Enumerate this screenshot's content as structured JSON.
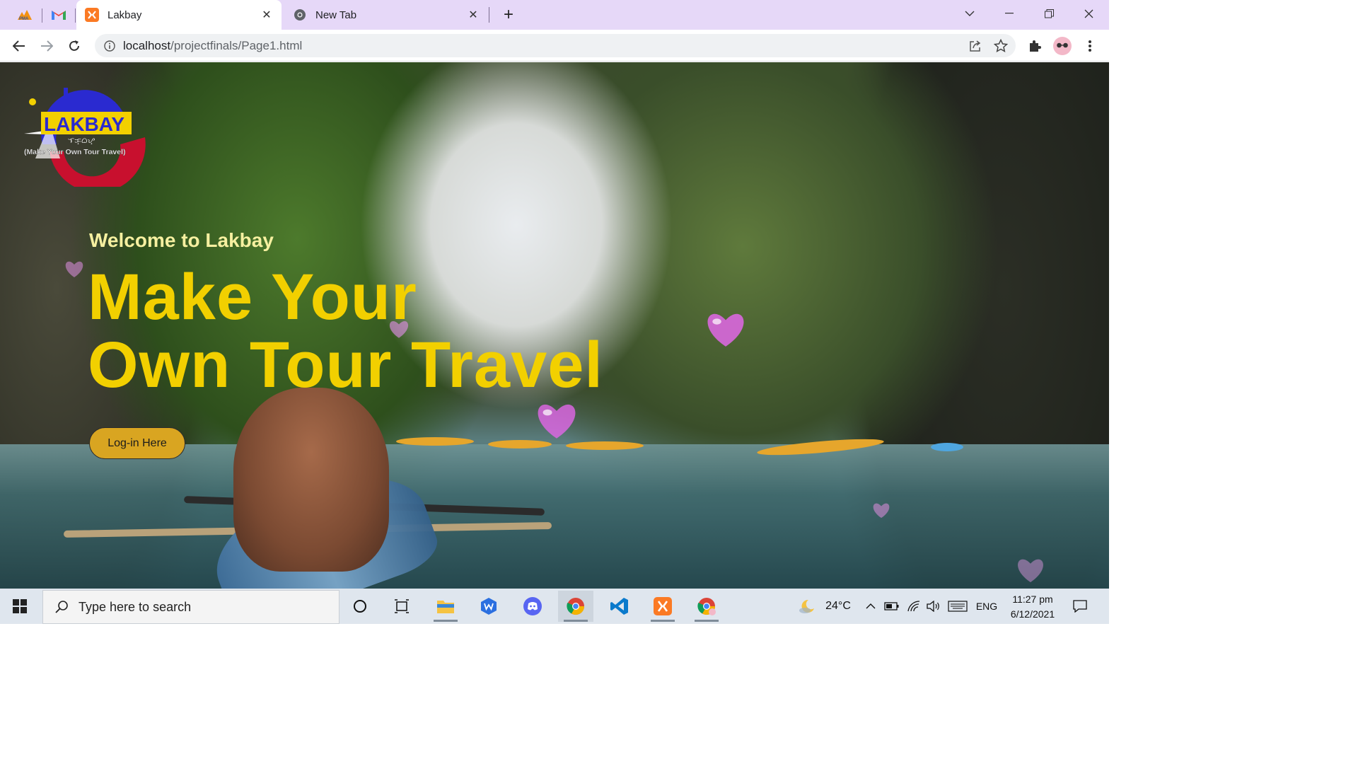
{
  "browser": {
    "tabs": [
      {
        "title": "Lakbay",
        "favicon": "xampp-icon",
        "active": true
      },
      {
        "title": "New Tab",
        "favicon": "chrome-icon",
        "active": false
      }
    ],
    "pinned_tabs": [
      "phpmyadmin-icon",
      "gmail-icon"
    ],
    "close_glyph": "✕",
    "new_tab_glyph": "+",
    "window_controls": {
      "dropdown": "⌄",
      "minimize": "—",
      "restore": "❐",
      "close": "✕"
    },
    "address_bar": {
      "host": "localhost",
      "path": "/projectfinals/Page1.html"
    }
  },
  "page": {
    "logo": {
      "word": "LAKBAY",
      "subtitle": "(Make Your Own Tour Travel)",
      "script": "ᜎᜃ᜔ᜊᜌ᜔"
    },
    "welcome": "Welcome to Lakbay",
    "headline_line1": "Make Your",
    "headline_line2": "Own Tour Travel",
    "login_button": "Log-in Here",
    "accent_color": "#f2d000",
    "button_color": "#d9a521"
  },
  "taskbar": {
    "search_placeholder": "Type here to search",
    "apps": [
      "cortana-icon",
      "task-view-icon",
      "file-explorer-icon",
      "wps-icon",
      "discord-icon",
      "chrome-icon",
      "vscode-icon",
      "xampp-icon",
      "chrome-profile-icon"
    ],
    "weather": "24°C",
    "language": "ENG",
    "time": "11:27 pm",
    "date": "6/12/2021"
  }
}
